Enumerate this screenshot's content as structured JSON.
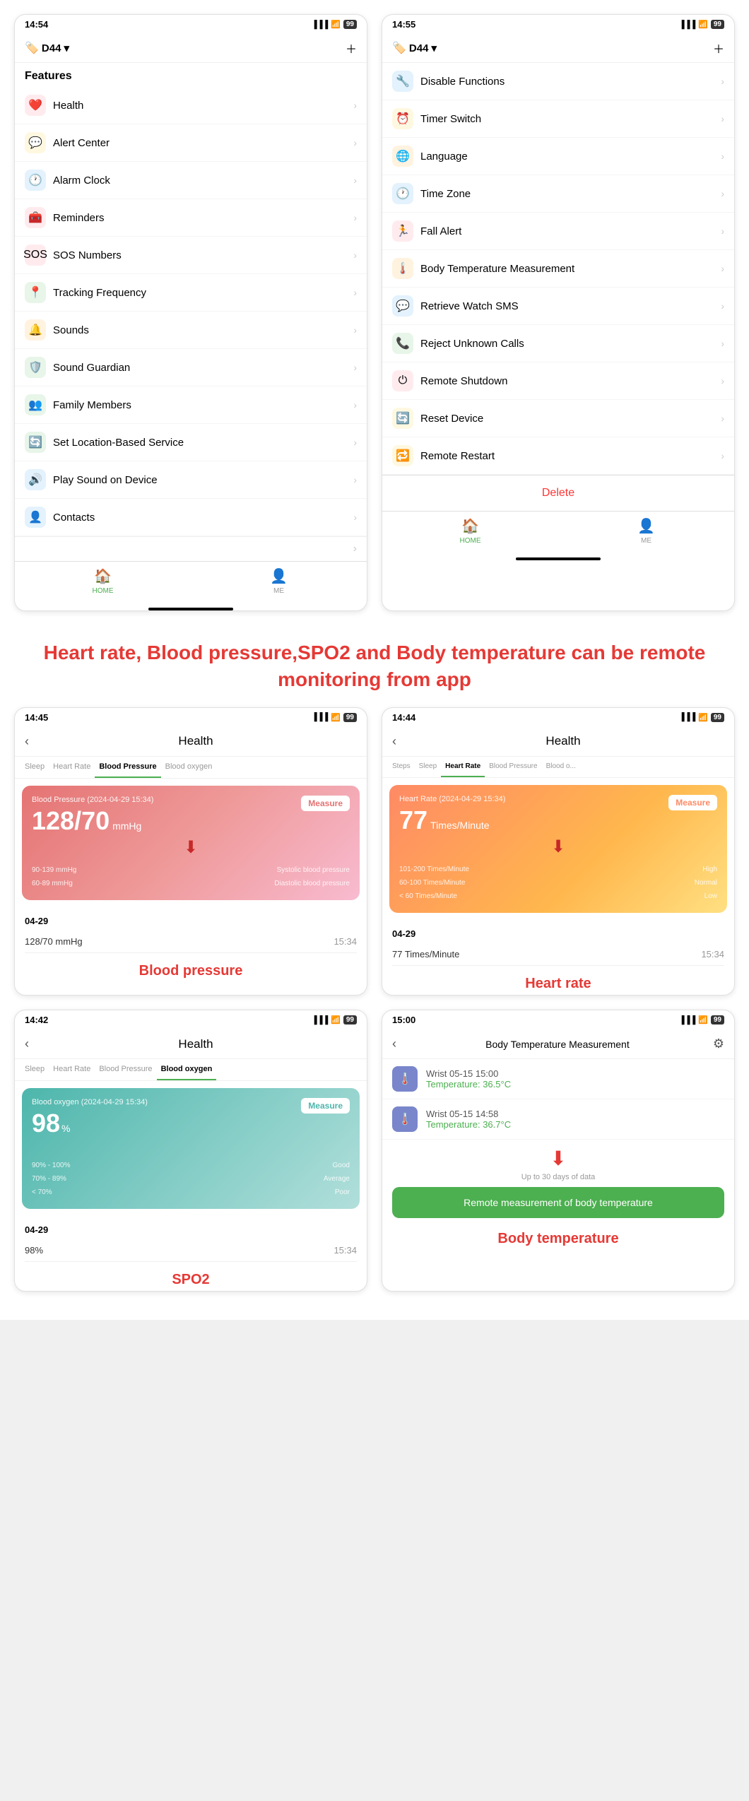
{
  "phone1": {
    "statusBar": {
      "time": "14:54",
      "battery": "99"
    },
    "deviceName": "D44",
    "features": {
      "sectionTitle": "Features",
      "items": [
        {
          "id": "health",
          "label": "Health",
          "icon": "❤️",
          "iconBg": "#ffebee"
        },
        {
          "id": "alert-center",
          "label": "Alert Center",
          "icon": "💬",
          "iconBg": "#fff8e1"
        },
        {
          "id": "alarm-clock",
          "label": "Alarm Clock",
          "icon": "🕐",
          "iconBg": "#e3f2fd"
        },
        {
          "id": "reminders",
          "label": "Reminders",
          "icon": "🧰",
          "iconBg": "#ffebee"
        },
        {
          "id": "sos-numbers",
          "label": "SOS Numbers",
          "icon": "🆘",
          "iconBg": "#ffebee"
        },
        {
          "id": "tracking-frequency",
          "label": "Tracking Frequency",
          "icon": "📍",
          "iconBg": "#e8f5e9"
        },
        {
          "id": "sounds",
          "label": "Sounds",
          "icon": "🔔",
          "iconBg": "#fff3e0"
        },
        {
          "id": "sound-guardian",
          "label": "Sound Guardian",
          "icon": "🛡️",
          "iconBg": "#e8f5e9"
        },
        {
          "id": "family-members",
          "label": "Family Members",
          "icon": "👥",
          "iconBg": "#e8f5e9"
        },
        {
          "id": "set-location",
          "label": "Set Location-Based Service",
          "icon": "🔄",
          "iconBg": "#e8f5e9"
        },
        {
          "id": "play-sound",
          "label": "Play Sound on Device",
          "icon": "🔊",
          "iconBg": "#e3f2fd"
        },
        {
          "id": "contacts",
          "label": "Contacts",
          "icon": "👤",
          "iconBg": "#e3f2fd"
        }
      ]
    },
    "bottomNav": {
      "home": "HOME",
      "me": "ME"
    }
  },
  "phone2": {
    "statusBar": {
      "time": "14:55",
      "battery": "99"
    },
    "deviceName": "D44",
    "items": [
      {
        "id": "disable-functions",
        "label": "Disable Functions",
        "icon": "🔧",
        "iconBg": "#e3f2fd"
      },
      {
        "id": "timer-switch",
        "label": "Timer Switch",
        "icon": "⏰",
        "iconBg": "#fff8e1"
      },
      {
        "id": "language",
        "label": "Language",
        "icon": "🌐",
        "iconBg": "#fff3e0"
      },
      {
        "id": "time-zone",
        "label": "Time Zone",
        "icon": "🕐",
        "iconBg": "#e3f2fd"
      },
      {
        "id": "fall-alert",
        "label": "Fall Alert",
        "icon": "🏃",
        "iconBg": "#ffebee"
      },
      {
        "id": "body-temp",
        "label": "Body Temperature Measurement",
        "icon": "🌡️",
        "iconBg": "#fff3e0"
      },
      {
        "id": "retrieve-sms",
        "label": "Retrieve Watch SMS",
        "icon": "💬",
        "iconBg": "#e3f2fd"
      },
      {
        "id": "reject-unknown",
        "label": "Reject Unknown Calls",
        "icon": "📞",
        "iconBg": "#e8f5e9"
      },
      {
        "id": "remote-shutdown",
        "label": "Remote Shutdown",
        "icon": "⏻",
        "iconBg": "#ffebee"
      },
      {
        "id": "reset-device",
        "label": "Reset Device",
        "icon": "🔄",
        "iconBg": "#fff8e1"
      },
      {
        "id": "remote-restart",
        "label": "Remote Restart",
        "icon": "🔁",
        "iconBg": "#fff8e1"
      }
    ],
    "deleteBtn": "Delete",
    "bottomNav": {
      "home": "HOME",
      "me": "ME"
    }
  },
  "banner": {
    "text": "Heart rate, Blood pressure,SPO2 and Body temperature can be remote monitoring from app"
  },
  "healthPhone1": {
    "statusBar": {
      "time": "14:45",
      "battery": "99"
    },
    "title": "Health",
    "tabs": [
      "Sleep",
      "Heart Rate",
      "Blood Pressure",
      "Blood oxygen"
    ],
    "activeTab": "Blood Pressure",
    "card": {
      "title": "Blood Pressure   (2024-04-29 15:34)",
      "value": "128/70",
      "unit": "mmHg",
      "measureBtn": "Measure",
      "ranges": [
        {
          "range": "90-139 mmHg",
          "label": "Systolic blood pressure"
        },
        {
          "range": "60-89 mmHg",
          "label": "Diastolic blood pressure"
        }
      ]
    },
    "records": {
      "date": "04-29",
      "entries": [
        {
          "value": "128/70 mmHg",
          "time": "15:34"
        }
      ]
    },
    "sectionLabel": "Blood pressure"
  },
  "healthPhone2": {
    "statusBar": {
      "time": "14:44",
      "battery": "99"
    },
    "title": "Health",
    "tabs": [
      "Steps",
      "Sleep",
      "Heart Rate",
      "Blood Pressure",
      "Blood o..."
    ],
    "activeTab": "Heart Rate",
    "card": {
      "title": "Heart Rate   (2024-04-29 15:34)",
      "value": "77",
      "unit": "Times/Minute",
      "measureBtn": "Measure",
      "ranges": [
        {
          "range": "101-200 Times/Minute",
          "label": "High"
        },
        {
          "range": "60-100 Times/Minute",
          "label": "Normal"
        },
        {
          "range": "< 60 Times/Minute",
          "label": "Low"
        }
      ]
    },
    "records": {
      "date": "04-29",
      "entries": [
        {
          "value": "77 Times/Minute",
          "time": "15:34"
        }
      ]
    },
    "sectionLabel": "Heart rate"
  },
  "healthPhone3": {
    "statusBar": {
      "time": "14:42",
      "battery": "99"
    },
    "title": "Health",
    "tabs": [
      "Sleep",
      "Heart Rate",
      "Blood Pressure",
      "Blood oxygen"
    ],
    "activeTab": "Blood oxygen",
    "card": {
      "title": "Blood oxygen   (2024-04-29 15:34)",
      "value": "98",
      "unit": "%",
      "measureBtn": "Measure",
      "ranges": [
        {
          "range": "90% - 100%",
          "label": "Good"
        },
        {
          "range": "70% - 89%",
          "label": "Average"
        },
        {
          "range": "< 70%",
          "label": "Poor"
        }
      ]
    },
    "records": {
      "date": "04-29",
      "entries": [
        {
          "value": "98%",
          "time": "15:34"
        }
      ]
    },
    "sectionLabel": "SPO2"
  },
  "healthPhone4": {
    "statusBar": {
      "time": "15:00",
      "battery": "99"
    },
    "title": "Body Temperature Measurement",
    "records": [
      {
        "label": "Wrist   05-15 15:00",
        "tempLabel": "Temperature:",
        "tempValue": "36.5°C"
      },
      {
        "label": "Wrist   05-15 14:58",
        "tempLabel": "Temperature:",
        "tempValue": "36.7°C"
      }
    ],
    "upToNote": "Up to 30 days of data",
    "remoteMeasureBtn": "Remote measurement of body temperature",
    "arrowNote": "",
    "sectionLabel": "Body temperature"
  }
}
